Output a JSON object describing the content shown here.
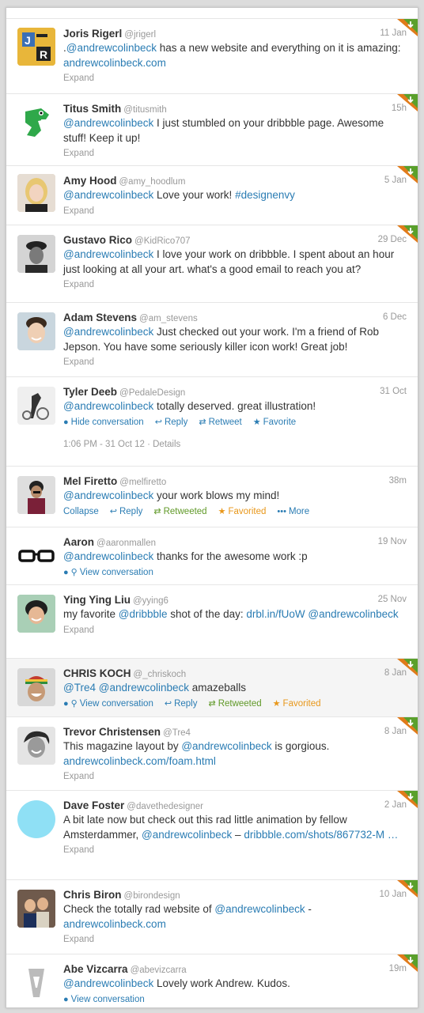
{
  "tweets": [
    {
      "name": "Joris Rigerl",
      "handle": "@jrigerl",
      "time": "11 Jan",
      "text": [
        {
          "t": ".",
          "l": false
        },
        {
          "t": "@andrewcolinbeck",
          "l": true
        },
        {
          "t": " has a new website and everything on it is amazing: ",
          "l": false
        },
        {
          "t": "andrewcolinbeck.com",
          "l": true
        }
      ],
      "action": "Expand"
    },
    {
      "name": "Titus Smith",
      "handle": "@titusmith",
      "time": "15h",
      "text": [
        {
          "t": "@andrewcolinbeck",
          "l": true
        },
        {
          "t": " I just stumbled on your dribbble page. Awesome stuff! Keep it up!",
          "l": false
        }
      ],
      "action": "Expand"
    },
    {
      "name": "Amy Hood",
      "handle": "@amy_hoodlum",
      "time": "5 Jan",
      "text": [
        {
          "t": "@andrewcolinbeck",
          "l": true
        },
        {
          "t": " Love your work! ",
          "l": false
        },
        {
          "t": "#designenvy",
          "l": true
        }
      ],
      "action": "Expand"
    },
    {
      "name": "Gustavo Rico",
      "handle": "@KidRico707",
      "time": "29 Dec",
      "text": [
        {
          "t": "@andrewcolinbeck",
          "l": true
        },
        {
          "t": " I love your work on dribbble. I spent about an hour just looking at all your art. what's a good email to reach you at?",
          "l": false
        }
      ],
      "action": "Expand"
    },
    {
      "name": "Adam Stevens",
      "handle": "@am_stevens",
      "time": "6 Dec",
      "text": [
        {
          "t": "@andrewcolinbeck",
          "l": true
        },
        {
          "t": " Just checked out your work. I'm a friend of Rob Jepson. You have some seriously killer icon work! Great job!",
          "l": false
        }
      ],
      "action": "Expand"
    },
    {
      "name": "Tyler Deeb",
      "handle": "@PedaleDesign",
      "time": "31 Oct",
      "text": [
        {
          "t": "@andrewcolinbeck",
          "l": true
        },
        {
          "t": " totally deserved. great illustration!",
          "l": false
        }
      ],
      "actions": [
        "Hide conversation",
        "Reply",
        "Retweet",
        "Favorite"
      ],
      "detail": "1:06 PM - 31 Oct 12 · Details"
    },
    {
      "name": "Mel Firetto",
      "handle": "@melfiretto",
      "time": "38m",
      "text": [
        {
          "t": "@andrewcolinbeck",
          "l": true
        },
        {
          "t": " your work blows my mind!",
          "l": false
        }
      ],
      "actions": [
        "Collapse",
        "Reply",
        "Retweeted",
        "Favorited",
        "More"
      ]
    },
    {
      "name": "Aaron",
      "handle": "@aaronmallen",
      "time": "19 Nov",
      "text": [
        {
          "t": "@andrewcolinbeck",
          "l": true
        },
        {
          "t": " thanks for the awesome work :p",
          "l": false
        }
      ],
      "actions": [
        "View conversation"
      ]
    },
    {
      "name": "Ying Ying Liu",
      "handle": "@yying6",
      "time": "25 Nov",
      "text": [
        {
          "t": "my favorite ",
          "l": false
        },
        {
          "t": "@dribbble",
          "l": true
        },
        {
          "t": " shot of the day: ",
          "l": false
        },
        {
          "t": "drbl.in/fUoW",
          "l": true
        },
        {
          "t": " ",
          "l": false
        },
        {
          "t": "@andrewcolinbeck",
          "l": true
        }
      ],
      "action": "Expand"
    },
    {
      "name": "CHRIS KOCH",
      "handle": "@_chriskoch",
      "time": "8 Jan",
      "text": [
        {
          "t": "@Tre4",
          "l": true
        },
        {
          "t": " ",
          "l": false
        },
        {
          "t": "@andrewcolinbeck",
          "l": true
        },
        {
          "t": " amazeballs",
          "l": false
        }
      ],
      "actions": [
        "View conversation",
        "Reply",
        "Retweeted",
        "Favorited"
      ]
    },
    {
      "name": "Trevor Christensen",
      "handle": "@Tre4",
      "time": "8 Jan",
      "text": [
        {
          "t": "This magazine layout by ",
          "l": false
        },
        {
          "t": "@andrewcolinbeck",
          "l": true
        },
        {
          "t": " is gorgious. ",
          "l": false
        },
        {
          "t": "andrewcolinbeck.com/foam.html",
          "l": true
        }
      ],
      "action": "Expand"
    },
    {
      "name": "Dave Foster",
      "handle": "@davethedesigner",
      "time": "2 Jan",
      "text": [
        {
          "t": "A bit late now but check out this rad little animation by fellow Amsterdammer, ",
          "l": false
        },
        {
          "t": "@andrewcolinbeck",
          "l": true
        },
        {
          "t": " – ",
          "l": false
        },
        {
          "t": "dribbble.com/shots/867732-M …",
          "l": true
        }
      ],
      "action": "Expand"
    },
    {
      "name": "Chris Biron",
      "handle": "@birondesign",
      "time": "10 Jan",
      "text": [
        {
          "t": "Check the totally rad website of ",
          "l": false
        },
        {
          "t": "@andrewcolinbeck",
          "l": true
        },
        {
          "t": " - ",
          "l": false
        },
        {
          "t": "andrewcolinbeck.com",
          "l": true
        }
      ],
      "action": "Expand"
    },
    {
      "name": "Abe Vizcarra",
      "handle": "@abevizcarra",
      "time": "19m",
      "text": [
        {
          "t": "@andrewcolinbeck",
          "l": true
        },
        {
          "t": " Lovely work Andrew. Kudos.",
          "l": false
        }
      ],
      "actions": [
        "View conversation"
      ]
    }
  ],
  "colors": {
    "link": "#2a7cb3",
    "green": "#609928",
    "orange": "#e8971a",
    "meta": "#999999"
  }
}
